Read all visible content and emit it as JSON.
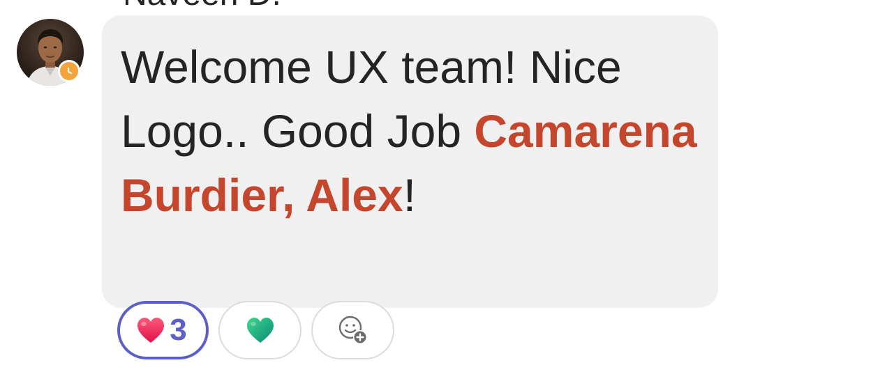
{
  "sender": {
    "name": "Naveen D."
  },
  "avatar": {
    "icon": "user-photo",
    "presence_icon": "clock-icon",
    "presence_color": "#f7a33c"
  },
  "message": {
    "text_line": "Welcome UX team! Nice Logo.. Good Job",
    "mention": "Camarena Burdier, Alex",
    "trailing": "!",
    "bubble_color": "#f0f0f0",
    "mention_color": "#c4462c"
  },
  "reactions": [
    {
      "icon": "red-heart-icon",
      "count": "3",
      "selected": true,
      "accent": "#5b5fc7"
    },
    {
      "icon": "green-heart-icon",
      "selected": false
    },
    {
      "icon": "add-reaction-icon",
      "selected": false
    }
  ]
}
